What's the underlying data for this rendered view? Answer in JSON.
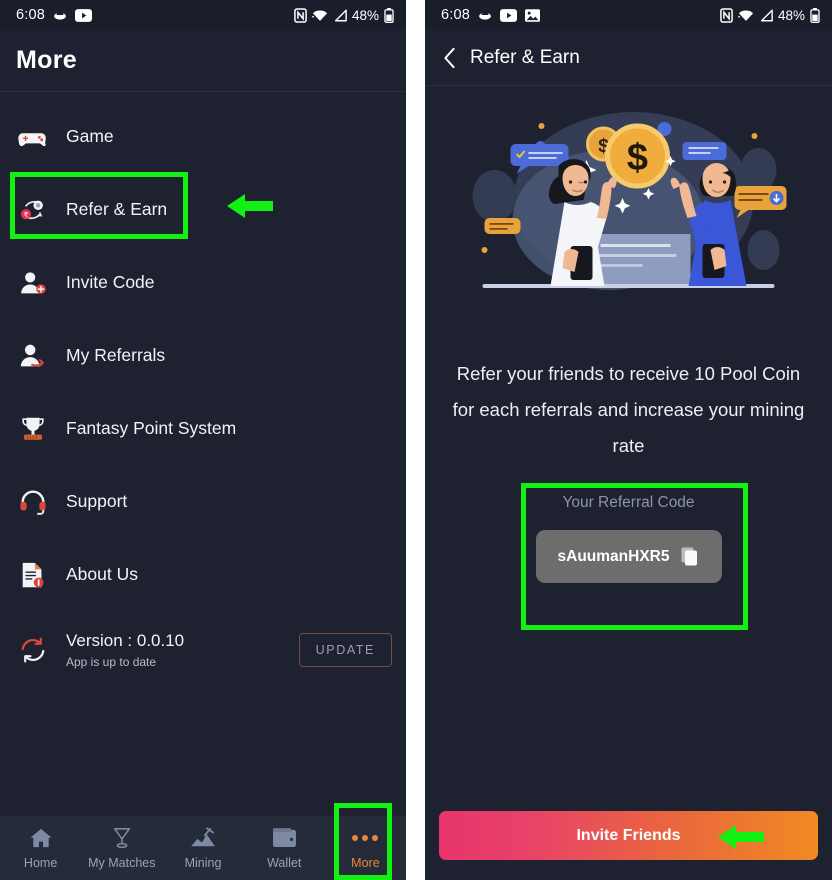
{
  "status_bar": {
    "time": "6:08",
    "battery_percent": "48%",
    "left_icons": [
      "cloud-icon",
      "youtube-icon"
    ],
    "left_icons_right_screen": [
      "cloud-icon",
      "youtube-icon",
      "image-icon"
    ],
    "right_icons": [
      "nfc-icon",
      "wifi-icon",
      "signal-icon",
      "battery-icon"
    ]
  },
  "left_screen": {
    "header": {
      "title": "More"
    },
    "menu": [
      {
        "label": "Game",
        "icon": "gamepad-icon"
      },
      {
        "label": "Refer & Earn",
        "icon": "refer-coin-icon",
        "highlighted": true
      },
      {
        "label": "Invite Code",
        "icon": "person-add-icon"
      },
      {
        "label": "My Referrals",
        "icon": "person-arrow-icon"
      },
      {
        "label": "Fantasy Point System",
        "icon": "trophy-icon"
      },
      {
        "label": "Support",
        "icon": "headset-icon"
      },
      {
        "label": "About Us",
        "icon": "document-info-icon"
      }
    ],
    "version": {
      "icon": "refresh-icon",
      "label": "Version : 0.0.10",
      "sub_label": "App is up to date",
      "update_button": "UPDATE"
    },
    "bottom_nav": [
      {
        "label": "Home",
        "icon": "home-icon",
        "active": false
      },
      {
        "label": "My Matches",
        "icon": "trophy-outline-icon",
        "active": false
      },
      {
        "label": "Mining",
        "icon": "pickaxe-icon",
        "active": false
      },
      {
        "label": "Wallet",
        "icon": "wallet-icon",
        "active": false
      },
      {
        "label": "More",
        "icon": "ellipsis-icon",
        "active": true
      }
    ]
  },
  "right_screen": {
    "appbar": {
      "back_icon": "chevron-left-icon",
      "title": "Refer & Earn"
    },
    "illustration": "two-people-high-five-with-dollar-coins",
    "promo_text": "Refer your friends to receive 10 Pool Coin for each referrals and increase your mining rate",
    "referral": {
      "caption": "Your Referral Code",
      "code": "sAuumanHXR5",
      "copy_icon": "copy-icon"
    },
    "cta": {
      "label": "Invite Friends"
    }
  },
  "annotations": {
    "highlight_color": "#14f014",
    "arrow_color": "#14f014",
    "boxes": [
      "refer-and-earn-menu-item",
      "more-nav-item",
      "referral-code-block"
    ],
    "arrows": [
      "arrow-pointing-to-refer-and-earn",
      "arrow-pointing-to-invite-friends"
    ]
  },
  "colors": {
    "background": "#1e2230",
    "nav_background": "#262b3a",
    "accent_orange": "#e8883a",
    "cta_gradient_start": "#e8356b",
    "cta_gradient_end": "#f08a22",
    "code_chip": "#6d6d6d"
  }
}
